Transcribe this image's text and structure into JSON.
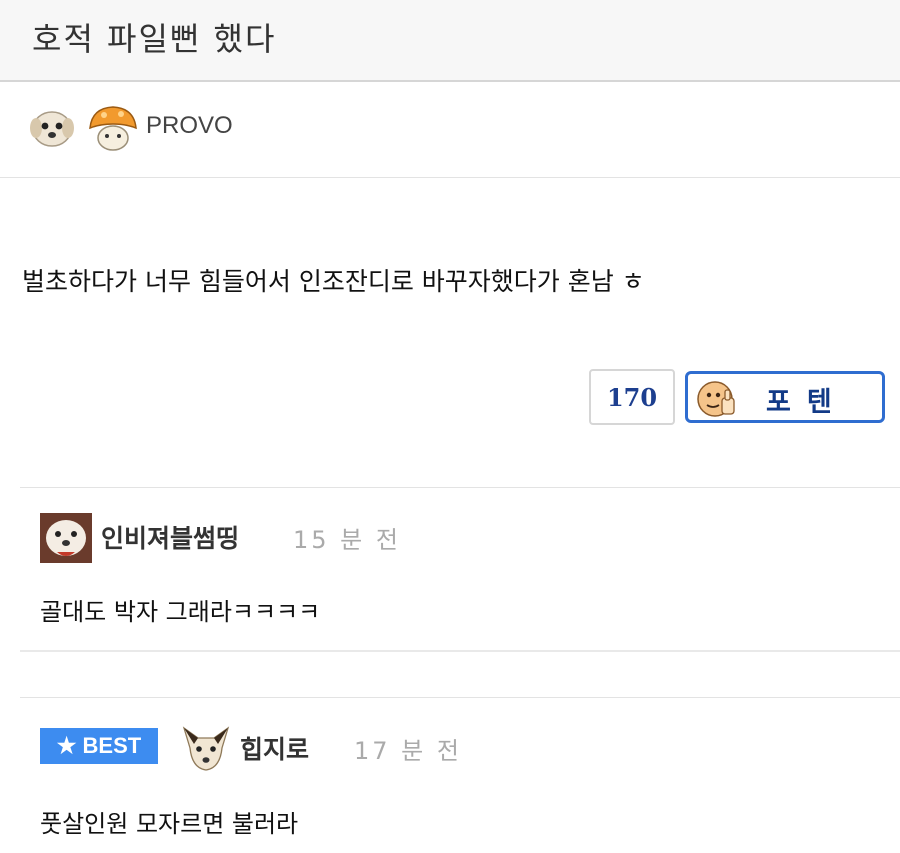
{
  "post": {
    "title": "호적 파일뻔 했다",
    "author": "PROVO",
    "body": "벌초하다가 너무 힘들어서 인조잔디로 바꾸자했다가 혼남 ㅎ",
    "vote_count": "170",
    "vote_button_label": "포텐"
  },
  "comments": [
    {
      "author": "인비져블썸띵",
      "time": "15 분 전",
      "text": "골대도 박자 그래라ㅋㅋㅋㅋ"
    },
    {
      "badge": "BEST",
      "author": "힙지로",
      "time": "17 분 전",
      "text": "풋살인원 모자르면 불러라"
    }
  ],
  "colors": {
    "best_badge": "#3d8cf0",
    "vote_border": "#2f6dd0",
    "vote_text": "#1d3f8f"
  }
}
